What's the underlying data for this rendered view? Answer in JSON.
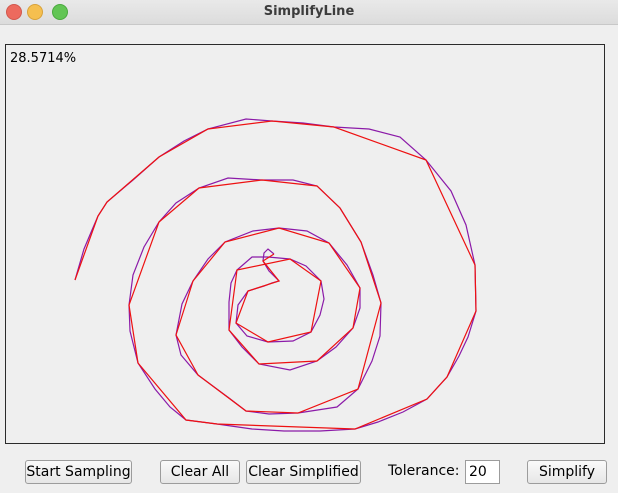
{
  "window": {
    "title": "SimplifyLine"
  },
  "canvas": {
    "percent": "28.5714%",
    "colors": {
      "original": "#8b1aa8",
      "simplified": "#ee1111"
    },
    "original": [
      [
        268,
        209
      ],
      [
        262,
        204
      ],
      [
        258,
        208
      ],
      [
        257,
        216
      ],
      [
        263,
        226
      ],
      [
        270,
        233
      ],
      [
        273,
        236
      ],
      [
        266,
        238
      ],
      [
        258,
        241
      ],
      [
        242,
        246
      ],
      [
        232,
        260
      ],
      [
        230,
        278
      ],
      [
        241,
        291
      ],
      [
        262,
        297
      ],
      [
        287,
        296
      ],
      [
        305,
        287
      ],
      [
        314,
        270
      ],
      [
        318,
        254
      ],
      [
        315,
        236
      ],
      [
        300,
        221
      ],
      [
        284,
        214
      ],
      [
        262,
        212
      ],
      [
        246,
        212
      ],
      [
        231,
        225
      ],
      [
        225,
        238
      ],
      [
        223,
        257
      ],
      [
        223,
        285
      ],
      [
        236,
        302
      ],
      [
        253,
        319
      ],
      [
        284,
        325
      ],
      [
        311,
        316
      ],
      [
        330,
        302
      ],
      [
        347,
        283
      ],
      [
        354,
        263
      ],
      [
        354,
        243
      ],
      [
        341,
        220
      ],
      [
        323,
        198
      ],
      [
        301,
        186
      ],
      [
        273,
        183
      ],
      [
        247,
        186
      ],
      [
        219,
        197
      ],
      [
        202,
        214
      ],
      [
        187,
        236
      ],
      [
        176,
        259
      ],
      [
        170,
        290
      ],
      [
        175,
        310
      ],
      [
        192,
        330
      ],
      [
        223,
        353
      ],
      [
        240,
        366
      ],
      [
        263,
        369
      ],
      [
        292,
        368
      ],
      [
        331,
        362
      ],
      [
        352,
        344
      ],
      [
        366,
        316
      ],
      [
        374,
        291
      ],
      [
        375,
        258
      ],
      [
        367,
        230
      ],
      [
        355,
        197
      ],
      [
        334,
        163
      ],
      [
        311,
        141
      ],
      [
        287,
        135
      ],
      [
        256,
        135
      ],
      [
        222,
        133
      ],
      [
        193,
        143
      ],
      [
        170,
        158
      ],
      [
        153,
        177
      ],
      [
        138,
        202
      ],
      [
        127,
        230
      ],
      [
        123,
        260
      ],
      [
        124,
        286
      ],
      [
        132,
        318
      ],
      [
        149,
        344
      ],
      [
        164,
        362
      ],
      [
        180,
        375
      ],
      [
        211,
        379
      ],
      [
        246,
        384
      ],
      [
        278,
        386
      ],
      [
        314,
        386
      ],
      [
        349,
        384
      ],
      [
        372,
        377
      ],
      [
        397,
        367
      ],
      [
        421,
        354
      ],
      [
        441,
        332
      ],
      [
        453,
        311
      ],
      [
        462,
        292
      ],
      [
        470,
        266
      ],
      [
        469,
        220
      ],
      [
        460,
        180
      ],
      [
        445,
        146
      ],
      [
        420,
        115
      ],
      [
        394,
        92
      ],
      [
        363,
        84
      ],
      [
        328,
        82
      ],
      [
        297,
        78
      ],
      [
        266,
        76
      ],
      [
        240,
        74
      ],
      [
        202,
        84
      ],
      [
        178,
        96
      ],
      [
        153,
        112
      ],
      [
        127,
        135
      ],
      [
        101,
        157
      ],
      [
        92,
        171
      ],
      [
        86,
        185
      ],
      [
        78,
        204
      ],
      [
        71,
        228
      ],
      [
        69,
        235
      ]
    ],
    "simplified": [
      [
        268,
        209
      ],
      [
        257,
        216
      ],
      [
        273,
        236
      ],
      [
        242,
        246
      ],
      [
        230,
        278
      ],
      [
        262,
        297
      ],
      [
        305,
        287
      ],
      [
        315,
        236
      ],
      [
        284,
        214
      ],
      [
        231,
        225
      ],
      [
        223,
        285
      ],
      [
        253,
        319
      ],
      [
        311,
        316
      ],
      [
        347,
        283
      ],
      [
        354,
        243
      ],
      [
        323,
        198
      ],
      [
        273,
        183
      ],
      [
        219,
        197
      ],
      [
        187,
        236
      ],
      [
        170,
        290
      ],
      [
        192,
        330
      ],
      [
        240,
        366
      ],
      [
        292,
        368
      ],
      [
        352,
        344
      ],
      [
        375,
        258
      ],
      [
        355,
        197
      ],
      [
        334,
        163
      ],
      [
        311,
        141
      ],
      [
        256,
        135
      ],
      [
        193,
        143
      ],
      [
        153,
        177
      ],
      [
        123,
        260
      ],
      [
        132,
        318
      ],
      [
        180,
        375
      ],
      [
        211,
        379
      ],
      [
        349,
        384
      ],
      [
        421,
        354
      ],
      [
        441,
        332
      ],
      [
        470,
        266
      ],
      [
        469,
        220
      ],
      [
        420,
        115
      ],
      [
        328,
        82
      ],
      [
        266,
        76
      ],
      [
        202,
        84
      ],
      [
        153,
        112
      ],
      [
        101,
        157
      ],
      [
        92,
        171
      ],
      [
        69,
        235
      ]
    ]
  },
  "controls": {
    "start_sampling": "Start Sampling",
    "clear_all": "Clear All",
    "clear_simplified": "Clear Simplified",
    "tolerance_label": "Tolerance:",
    "tolerance_value": "20",
    "simplify": "Simplify"
  }
}
